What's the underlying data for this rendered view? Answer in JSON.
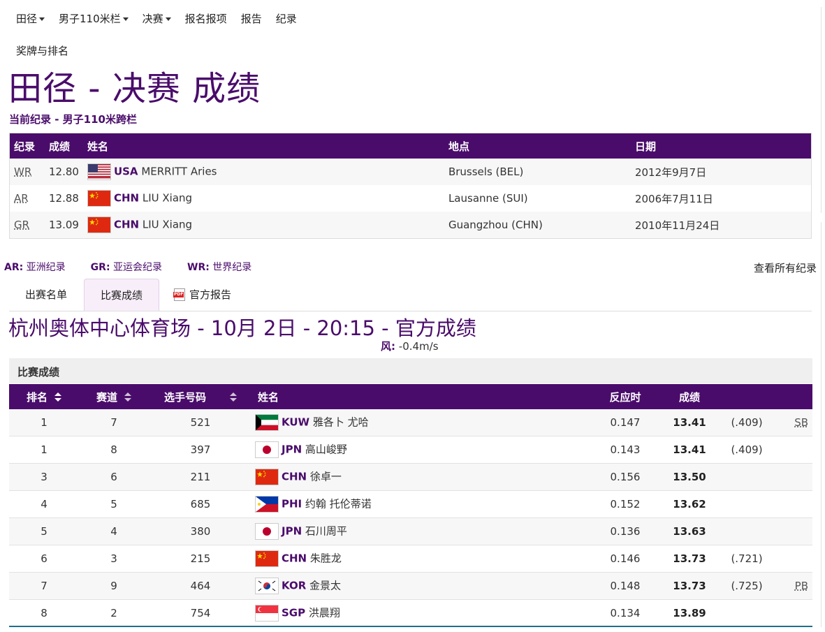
{
  "nav": {
    "items": [
      {
        "label": "田径",
        "dropdown": true
      },
      {
        "label": "男子110米栏",
        "dropdown": true
      },
      {
        "label": "决赛",
        "dropdown": true
      },
      {
        "label": "报名报项",
        "dropdown": false
      },
      {
        "label": "报告",
        "dropdown": false
      },
      {
        "label": "纪录",
        "dropdown": false
      }
    ],
    "medals": "奖牌与排名"
  },
  "page_title": "田径 - 决赛 成绩",
  "records": {
    "title": "当前纪录 - 男子110米跨栏",
    "headers": [
      "纪录",
      "成绩",
      "姓名",
      "地点",
      "日期"
    ],
    "rows": [
      {
        "type": "WR",
        "mark": "12.80",
        "flag": "USA",
        "noc": "USA",
        "name": "MERRITT Aries",
        "place": "Brussels (BEL)",
        "date": "2012年9月7日"
      },
      {
        "type": "AR",
        "mark": "12.88",
        "flag": "CHN",
        "noc": "CHN",
        "name": "LIU Xiang",
        "place": "Lausanne (SUI)",
        "date": "2006年7月11日"
      },
      {
        "type": "GR",
        "mark": "13.09",
        "flag": "CHN",
        "noc": "CHN",
        "name": "LIU Xiang",
        "place": "Guangzhou (CHN)",
        "date": "2010年11月24日"
      }
    ]
  },
  "legend": [
    {
      "abbr": "AR:",
      "text": "亚洲纪录"
    },
    {
      "abbr": "GR:",
      "text": "亚运会纪录"
    },
    {
      "abbr": "WR:",
      "text": "世界纪录"
    }
  ],
  "all_records": "查看所有纪录",
  "tabs": [
    {
      "label": "出赛名单",
      "active": false
    },
    {
      "label": "比赛成绩",
      "active": true
    },
    {
      "label": "官方报告",
      "active": false,
      "icon": "pdf-icon"
    }
  ],
  "venue": "杭州奥体中心体育场 - 10月 2日 - 20:15 - 官方成绩",
  "wind": {
    "label": "风:",
    "value": "-0.4m/s"
  },
  "results_panel_title": "比赛成绩",
  "results": {
    "headers": [
      "排名",
      "赛道",
      "选手号码",
      "姓名",
      "反应时",
      "成绩"
    ],
    "rows": [
      {
        "rank": "1",
        "lane": "7",
        "bib": "521",
        "flag": "KUW",
        "noc": "KUW",
        "name": "雅各卜 尤哈",
        "react": "0.147",
        "mark": "13.41",
        "tie": "(.409)",
        "rec": "SB"
      },
      {
        "rank": "1",
        "lane": "8",
        "bib": "397",
        "flag": "JPN",
        "noc": "JPN",
        "name": "高山峻野",
        "react": "0.143",
        "mark": "13.41",
        "tie": "(.409)",
        "rec": ""
      },
      {
        "rank": "3",
        "lane": "6",
        "bib": "211",
        "flag": "CHN",
        "noc": "CHN",
        "name": "徐卓一",
        "react": "0.156",
        "mark": "13.50",
        "tie": "",
        "rec": ""
      },
      {
        "rank": "4",
        "lane": "5",
        "bib": "685",
        "flag": "PHI",
        "noc": "PHI",
        "name": "约翰 托伦蒂诺",
        "react": "0.152",
        "mark": "13.62",
        "tie": "",
        "rec": ""
      },
      {
        "rank": "5",
        "lane": "4",
        "bib": "380",
        "flag": "JPN",
        "noc": "JPN",
        "name": "石川周平",
        "react": "0.136",
        "mark": "13.63",
        "tie": "",
        "rec": ""
      },
      {
        "rank": "6",
        "lane": "3",
        "bib": "215",
        "flag": "CHN",
        "noc": "CHN",
        "name": "朱胜龙",
        "react": "0.146",
        "mark": "13.73",
        "tie": "(.721)",
        "rec": ""
      },
      {
        "rank": "7",
        "lane": "9",
        "bib": "464",
        "flag": "KOR",
        "noc": "KOR",
        "name": "金景太",
        "react": "0.148",
        "mark": "13.73",
        "tie": "(.725)",
        "rec": "PB"
      },
      {
        "rank": "8",
        "lane": "2",
        "bib": "754",
        "flag": "SGP",
        "noc": "SGP",
        "name": "洪晨翔",
        "react": "0.134",
        "mark": "13.89",
        "tie": "",
        "rec": ""
      }
    ]
  },
  "colors": {
    "primary": "#4a0c6b",
    "panel": "#efefef",
    "stripe": "#f7f7f7"
  }
}
